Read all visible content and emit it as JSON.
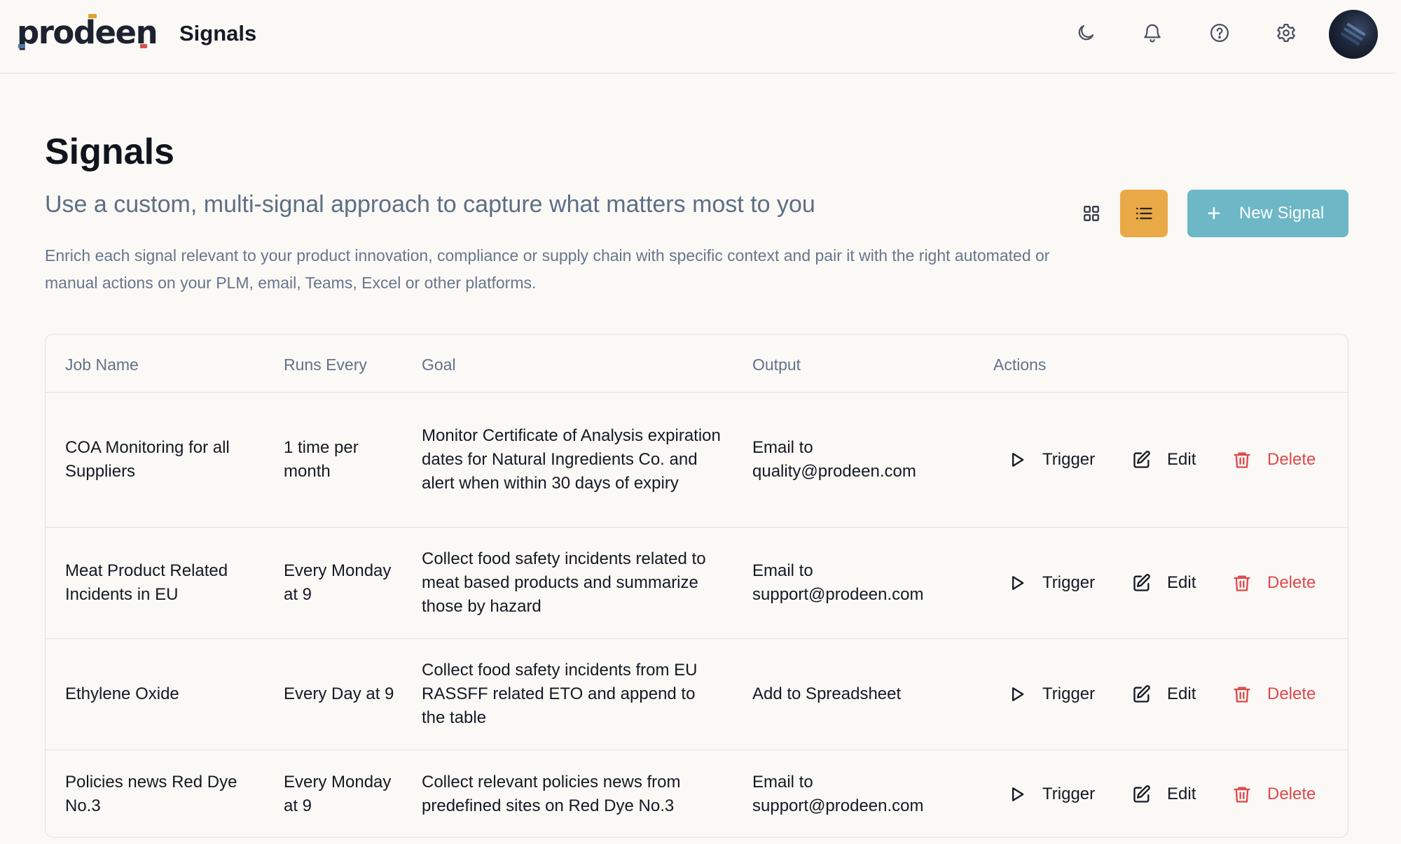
{
  "header": {
    "logo": "prodeen",
    "app_title": "Signals",
    "icons": [
      "moon-icon",
      "bell-icon",
      "help-icon",
      "gear-icon"
    ]
  },
  "page": {
    "title": "Signals",
    "subtitle": "Use a custom, multi-signal approach to capture what matters most to you",
    "description": "Enrich each signal relevant to your product innovation, compliance or supply chain with specific context and pair it with the right automated or manual actions on your PLM, email, Teams, Excel or other platforms.",
    "new_button_label": "New Signal",
    "active_view": "list"
  },
  "colors": {
    "accent_orange": "#e9a947",
    "primary_teal": "#6db7c6",
    "delete_red": "#e0484a"
  },
  "table": {
    "headers": {
      "job_name": "Job Name",
      "runs_every": "Runs Every",
      "goal": "Goal",
      "output": "Output",
      "actions": "Actions"
    },
    "action_labels": {
      "trigger": "Trigger",
      "edit": "Edit",
      "delete": "Delete"
    },
    "rows": [
      {
        "job_name": "COA Monitoring for all Suppliers",
        "runs_every": "1 time per month",
        "goal": "Monitor Certificate of Analysis expiration dates for Natural Ingredients Co. and alert when within 30 days of expiry",
        "output": "Email to quality@prodeen.com"
      },
      {
        "job_name": "Meat Product Related Incidents in EU",
        "runs_every": "Every Monday at 9",
        "goal": "Collect food safety incidents related to meat based products and summarize those by hazard",
        "output": "Email to support@prodeen.com"
      },
      {
        "job_name": "Ethylene Oxide",
        "runs_every": "Every Day at 9",
        "goal": "Collect food safety incidents from EU RASSFF related ETO and append to the table",
        "output": "Add to Spreadsheet"
      },
      {
        "job_name": "Policies news Red Dye No.3",
        "runs_every": "Every Monday at 9",
        "goal": "Collect relevant policies news from predefined sites on Red Dye No.3",
        "output": "Email to support@prodeen.com"
      }
    ]
  }
}
